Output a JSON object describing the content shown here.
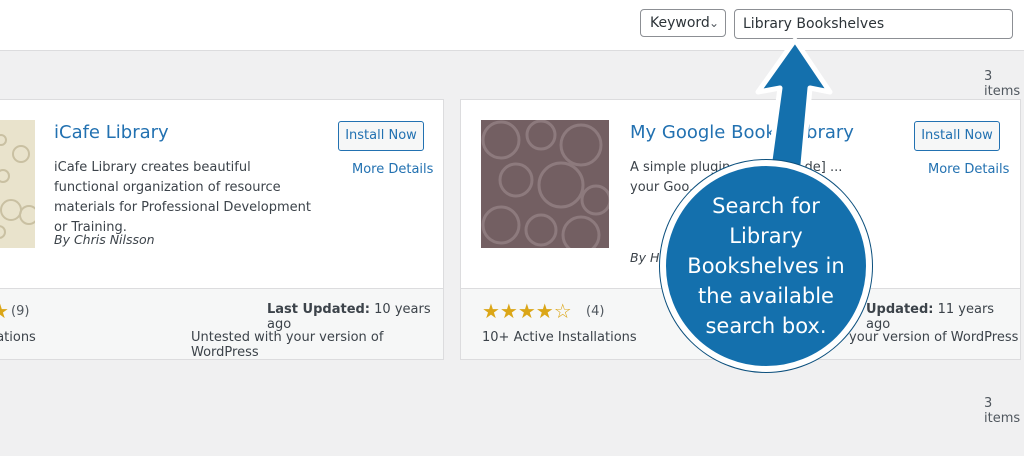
{
  "search": {
    "type_select": "Keyword",
    "query": "Library Bookshelves",
    "item_count_top": "3 items",
    "item_count_bottom": "3 items"
  },
  "plugins": [
    {
      "name": "iCafe Library",
      "install_label": "Install Now",
      "more_label": "More Details",
      "description": "iCafe Library creates beautiful functional organization of resource materials for Professional Development or Training.",
      "author": "By Chris Nilsson",
      "rating_count": "(9)",
      "installs": "allations",
      "last_updated_label": "Last Updated:",
      "last_updated_value": "10 years ago",
      "compat": "Untested with your version of WordPress"
    },
    {
      "name": "My Google Books Library",
      "install_label": "Install Now",
      "more_label": "More Details",
      "description": "A simple plugin ... [shortcode] ... your Goo... custom...",
      "author": "By Hu",
      "rating": 4,
      "rating_count": "(4)",
      "installs": "10+ Active Installations",
      "last_updated_label": "Updated:",
      "last_updated_value": "11 years ago",
      "compat": "your version of WordPress"
    }
  ],
  "callout": {
    "text": "Search for Library Bookshelves in the available search box."
  },
  "colors": {
    "accent": "#2271b1",
    "star": "#dba617",
    "callout_bg": "#1470ad"
  }
}
